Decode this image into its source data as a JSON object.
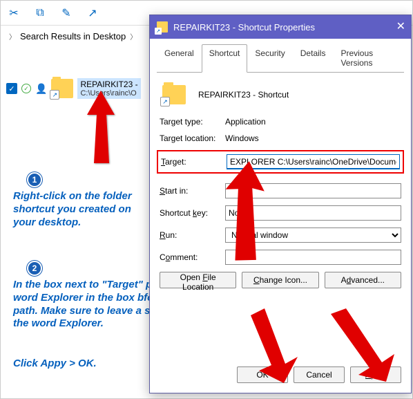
{
  "toolbar": {
    "icons": [
      "cut",
      "copy",
      "rename",
      "share"
    ]
  },
  "breadcrumb": {
    "label": "Search Results in Desktop"
  },
  "file": {
    "name": "REPAIRKIT23 -",
    "path": "C:\\Users\\rainc\\O"
  },
  "instructions": {
    "step1": "Right-click on the folder shortcut you created on your desktop.",
    "step2": "In the box next to \"Target\" put the word Explorer in the box bfore the file path. Make sure to leave a space after the word Explorer.",
    "step3": "Click Appy > OK."
  },
  "dialog": {
    "title": "REPAIRKIT23 - Shortcut Properties",
    "tabs": {
      "general": "General",
      "shortcut": "Shortcut",
      "security": "Security",
      "details": "Details",
      "previous": "Previous Versions"
    },
    "header_name": "REPAIRKIT23 - Shortcut",
    "fields": {
      "target_type_label": "Target type:",
      "target_type_value": "Application",
      "target_location_label": "Target location:",
      "target_location_value": "Windows",
      "target_label": "Target:",
      "target_value": "EXPLORER C:\\Users\\rainc\\OneDrive\\Documents\\",
      "start_in_label": "Start in:",
      "start_in_value": "",
      "shortcut_key_label": "Shortcut key:",
      "shortcut_key_value": "None",
      "run_label": "Run:",
      "run_value": "Normal window",
      "comment_label": "Comment:",
      "comment_value": ""
    },
    "buttons": {
      "open_file": "Open File Location",
      "change_icon": "Change Icon...",
      "advanced": "Advanced...",
      "ok": "OK",
      "cancel": "Cancel",
      "apply": "Apply"
    }
  }
}
